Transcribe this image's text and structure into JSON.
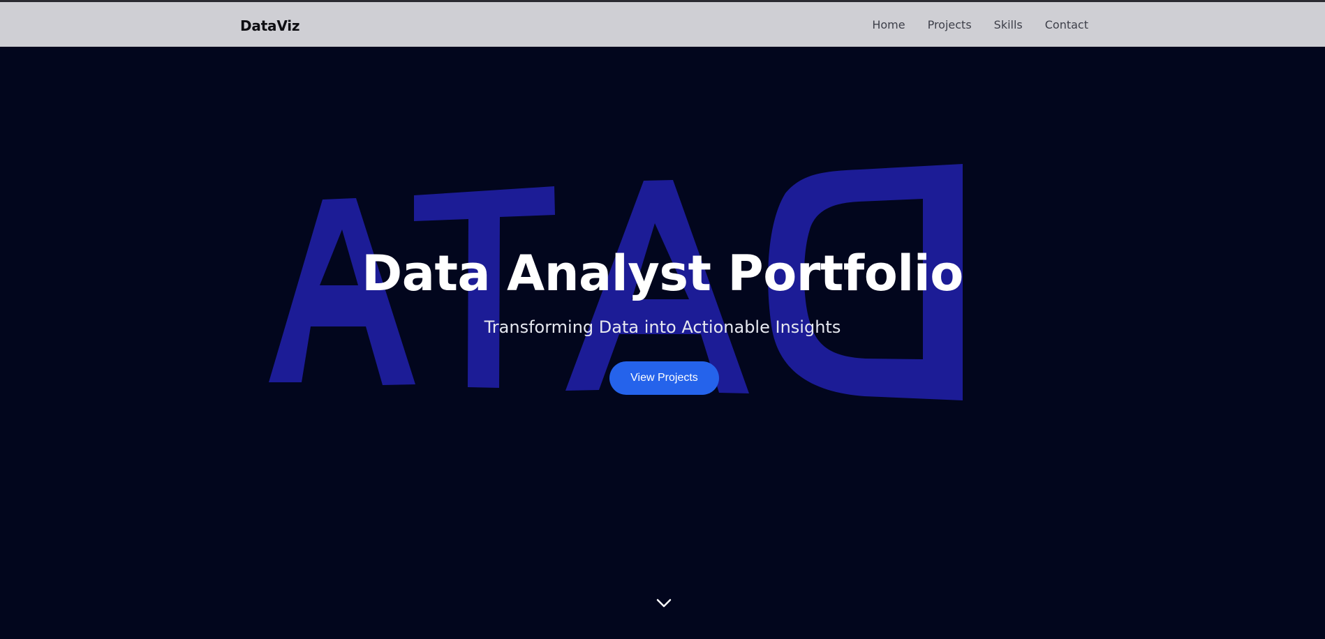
{
  "navbar": {
    "brand": "DataViz",
    "links": [
      {
        "label": "Home"
      },
      {
        "label": "Projects"
      },
      {
        "label": "Skills"
      },
      {
        "label": "Contact"
      }
    ]
  },
  "hero": {
    "background_word": "ATAD",
    "title": "Data Analyst Portfolio",
    "subtitle": "Transforming Data into Actionable Insights",
    "cta_label": "View Projects",
    "scroll_icon": "chevron-down-icon"
  },
  "colors": {
    "navbar_bg": "#cfcfd4",
    "hero_bg": "#02061d",
    "letters": "#1c1c96",
    "accent": "#2563eb",
    "text_light": "#ffffff"
  }
}
